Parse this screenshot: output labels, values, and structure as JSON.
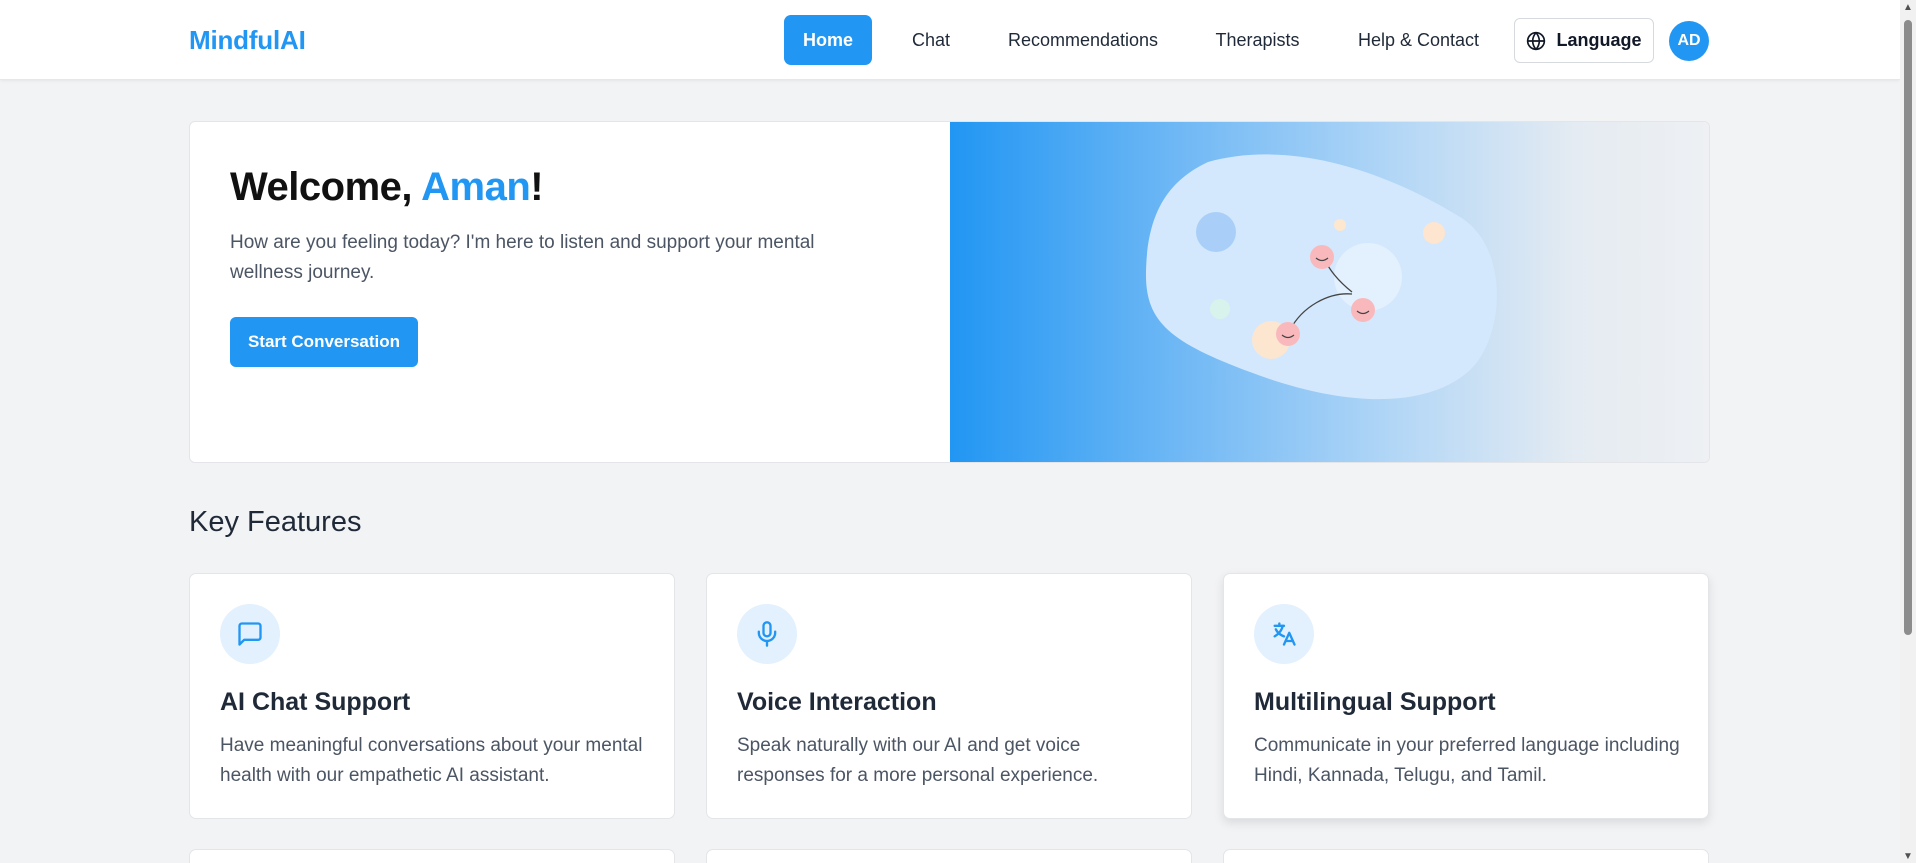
{
  "app": {
    "brand": "MindfulAI"
  },
  "nav": {
    "items": [
      {
        "label": "Home",
        "active": true
      },
      {
        "label": "Chat",
        "active": false
      },
      {
        "label": "Recommendations",
        "active": false
      },
      {
        "label": "Therapists",
        "active": false
      },
      {
        "label": "Help & Contact",
        "active": false
      }
    ],
    "language_label": "Language",
    "avatar_initials": "AD"
  },
  "hero": {
    "greeting": "Welcome, ",
    "user_name": "Aman",
    "greeting_suffix": "!",
    "subtitle": "How are you feeling today? I'm here to listen and support your mental wellness journey.",
    "cta_label": "Start Conversation"
  },
  "features": {
    "heading": "Key Features",
    "cards": [
      {
        "icon": "chat-bubble-icon",
        "title": "AI Chat Support",
        "description": "Have meaningful conversations about your mental health with our empathetic AI assistant."
      },
      {
        "icon": "microphone-icon",
        "title": "Voice Interaction",
        "description": "Speak naturally with our AI and get voice responses for a more personal experience."
      },
      {
        "icon": "translate-icon",
        "title": "Multilingual Support",
        "description": "Communicate in your preferred language including Hindi, Kannada, Telugu, and Tamil."
      }
    ]
  },
  "colors": {
    "accent": "#2196f3",
    "background": "#f2f3f5",
    "icon_bg": "#e3f0fd"
  }
}
